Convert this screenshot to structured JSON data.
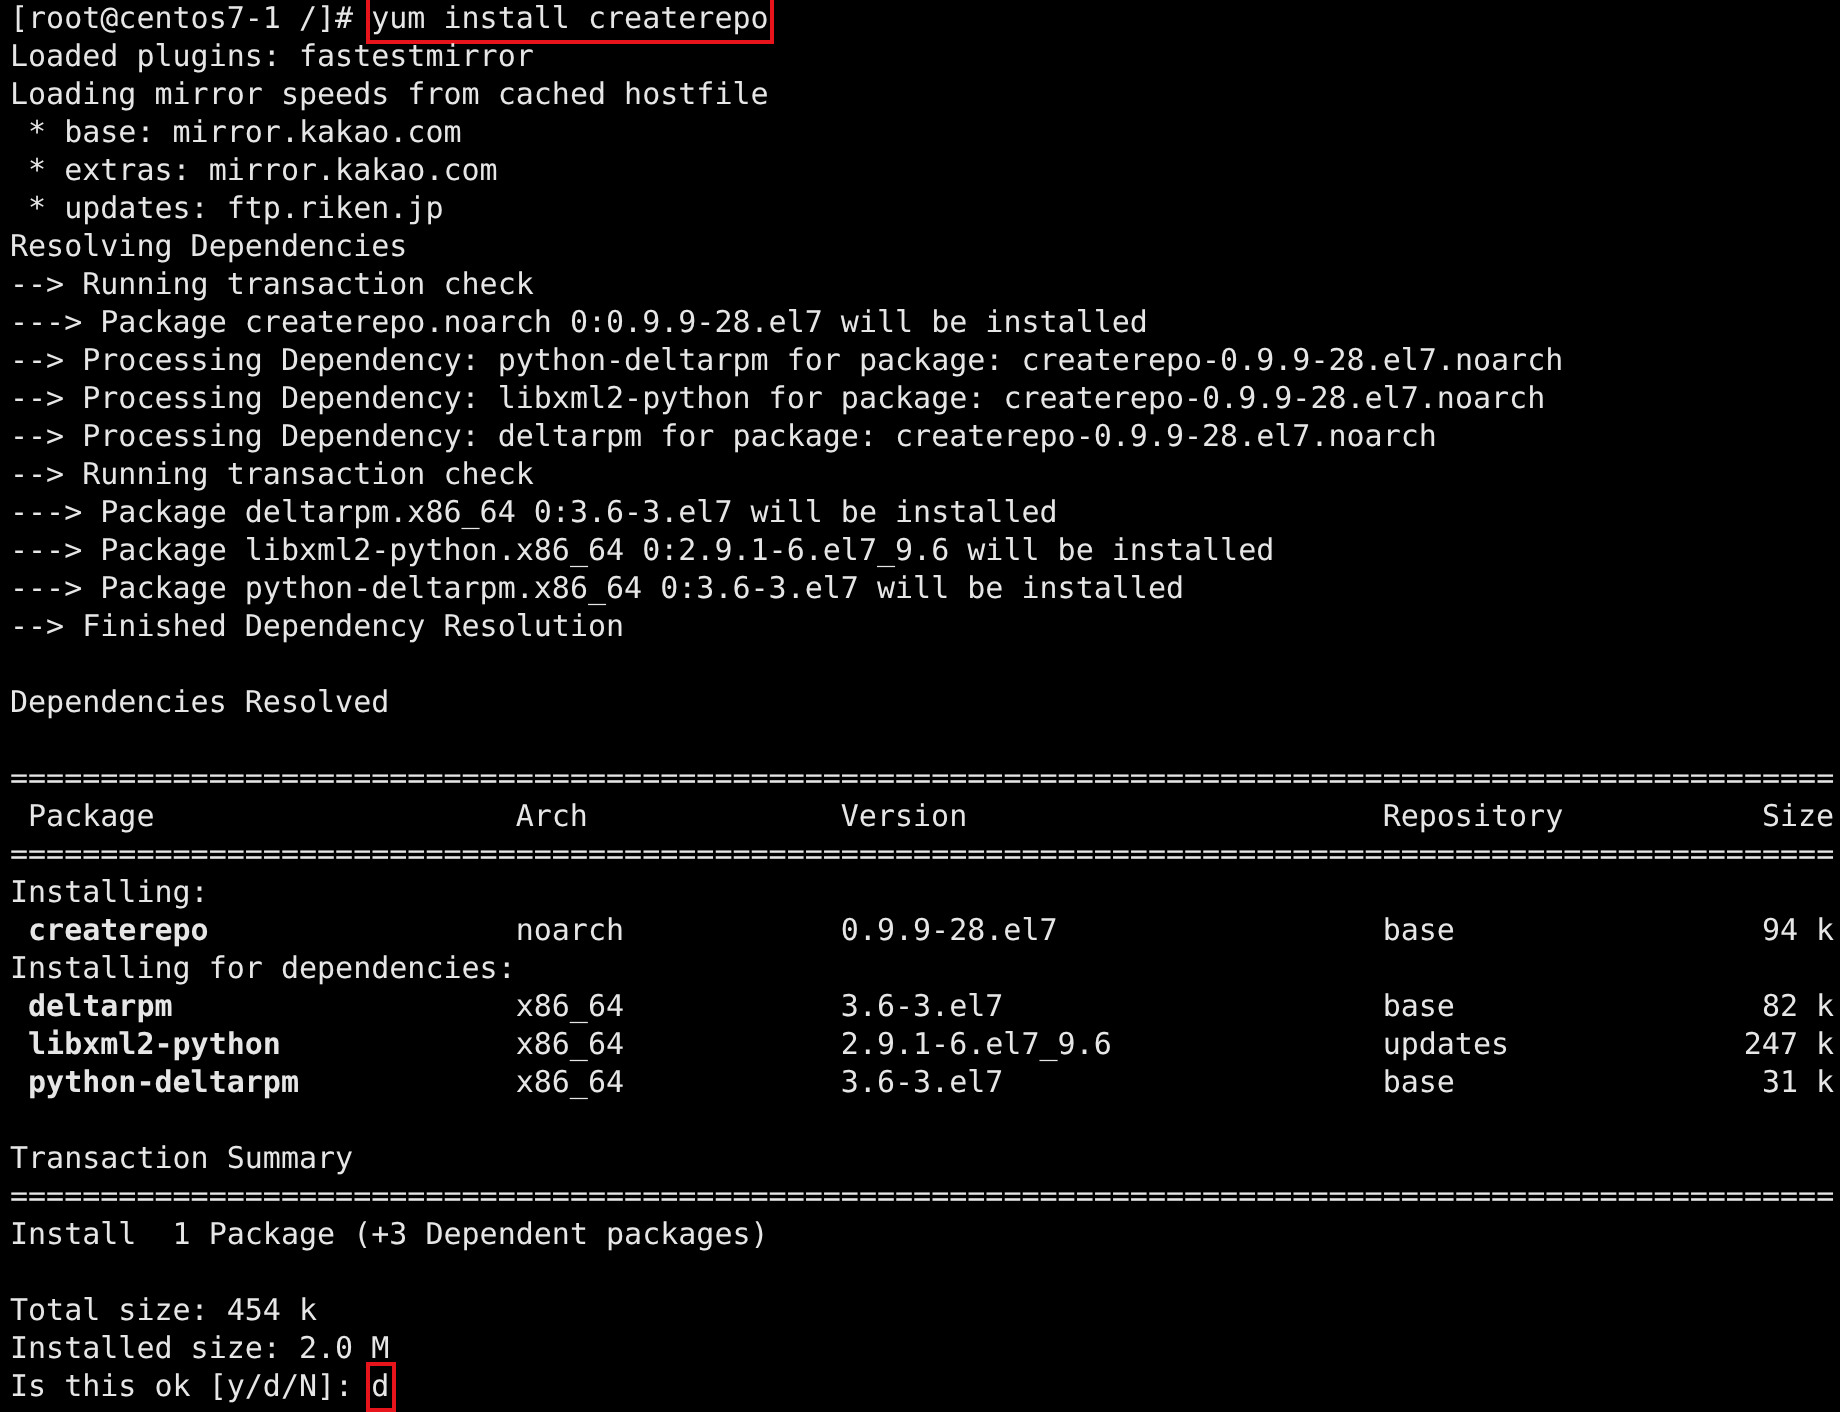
{
  "terminal": {
    "lines": [
      {
        "kind": "prompt",
        "prompt": "[root@centos7-1 /]# ",
        "input": "yum install createrepo",
        "highlighted": true
      },
      {
        "kind": "text",
        "text": "Loaded plugins: fastestmirror"
      },
      {
        "kind": "text",
        "text": "Loading mirror speeds from cached hostfile"
      },
      {
        "kind": "text",
        "text": " * base: mirror.kakao.com"
      },
      {
        "kind": "text",
        "text": " * extras: mirror.kakao.com"
      },
      {
        "kind": "text",
        "text": " * updates: ftp.riken.jp"
      },
      {
        "kind": "text",
        "text": "Resolving Dependencies"
      },
      {
        "kind": "text",
        "text": "--> Running transaction check"
      },
      {
        "kind": "text",
        "text": "---> Package createrepo.noarch 0:0.9.9-28.el7 will be installed"
      },
      {
        "kind": "text",
        "text": "--> Processing Dependency: python-deltarpm for package: createrepo-0.9.9-28.el7.noarch"
      },
      {
        "kind": "text",
        "text": "--> Processing Dependency: libxml2-python for package: createrepo-0.9.9-28.el7.noarch"
      },
      {
        "kind": "text",
        "text": "--> Processing Dependency: deltarpm for package: createrepo-0.9.9-28.el7.noarch"
      },
      {
        "kind": "text",
        "text": "--> Running transaction check"
      },
      {
        "kind": "text",
        "text": "---> Package deltarpm.x86_64 0:3.6-3.el7 will be installed"
      },
      {
        "kind": "text",
        "text": "---> Package libxml2-python.x86_64 0:2.9.1-6.el7_9.6 will be installed"
      },
      {
        "kind": "text",
        "text": "---> Package python-deltarpm.x86_64 0:3.6-3.el7 will be installed"
      },
      {
        "kind": "text",
        "text": "--> Finished Dependency Resolution"
      },
      {
        "kind": "blank"
      },
      {
        "kind": "text",
        "text": "Dependencies Resolved"
      },
      {
        "kind": "blank"
      },
      {
        "kind": "rule",
        "text": "====================================================================================================="
      },
      {
        "kind": "header",
        "cells": [
          "Package",
          "Arch",
          "Version",
          "Repository",
          "Size"
        ]
      },
      {
        "kind": "rule",
        "text": "====================================================================================================="
      },
      {
        "kind": "text",
        "text": "Installing:"
      },
      {
        "kind": "row",
        "cells": [
          "createrepo",
          "noarch",
          "0.9.9-28.el7",
          "base",
          "94 k"
        ]
      },
      {
        "kind": "text",
        "text": "Installing for dependencies:"
      },
      {
        "kind": "row",
        "cells": [
          "deltarpm",
          "x86_64",
          "3.6-3.el7",
          "base",
          "82 k"
        ]
      },
      {
        "kind": "row",
        "cells": [
          "libxml2-python",
          "x86_64",
          "2.9.1-6.el7_9.6",
          "updates",
          "247 k"
        ]
      },
      {
        "kind": "row",
        "cells": [
          "python-deltarpm",
          "x86_64",
          "3.6-3.el7",
          "base",
          "31 k"
        ]
      },
      {
        "kind": "blank"
      },
      {
        "kind": "text",
        "text": "Transaction Summary"
      },
      {
        "kind": "rule",
        "text": "====================================================================================================="
      },
      {
        "kind": "text",
        "text": "Install  1 Package (+3 Dependent packages)"
      },
      {
        "kind": "blank"
      },
      {
        "kind": "text",
        "text": "Total size: 454 k"
      },
      {
        "kind": "text",
        "text": "Installed size: 2.0 M"
      },
      {
        "kind": "prompt",
        "prompt": "Is this ok [y/d/N]: ",
        "input": "d",
        "highlighted": true
      }
    ]
  }
}
